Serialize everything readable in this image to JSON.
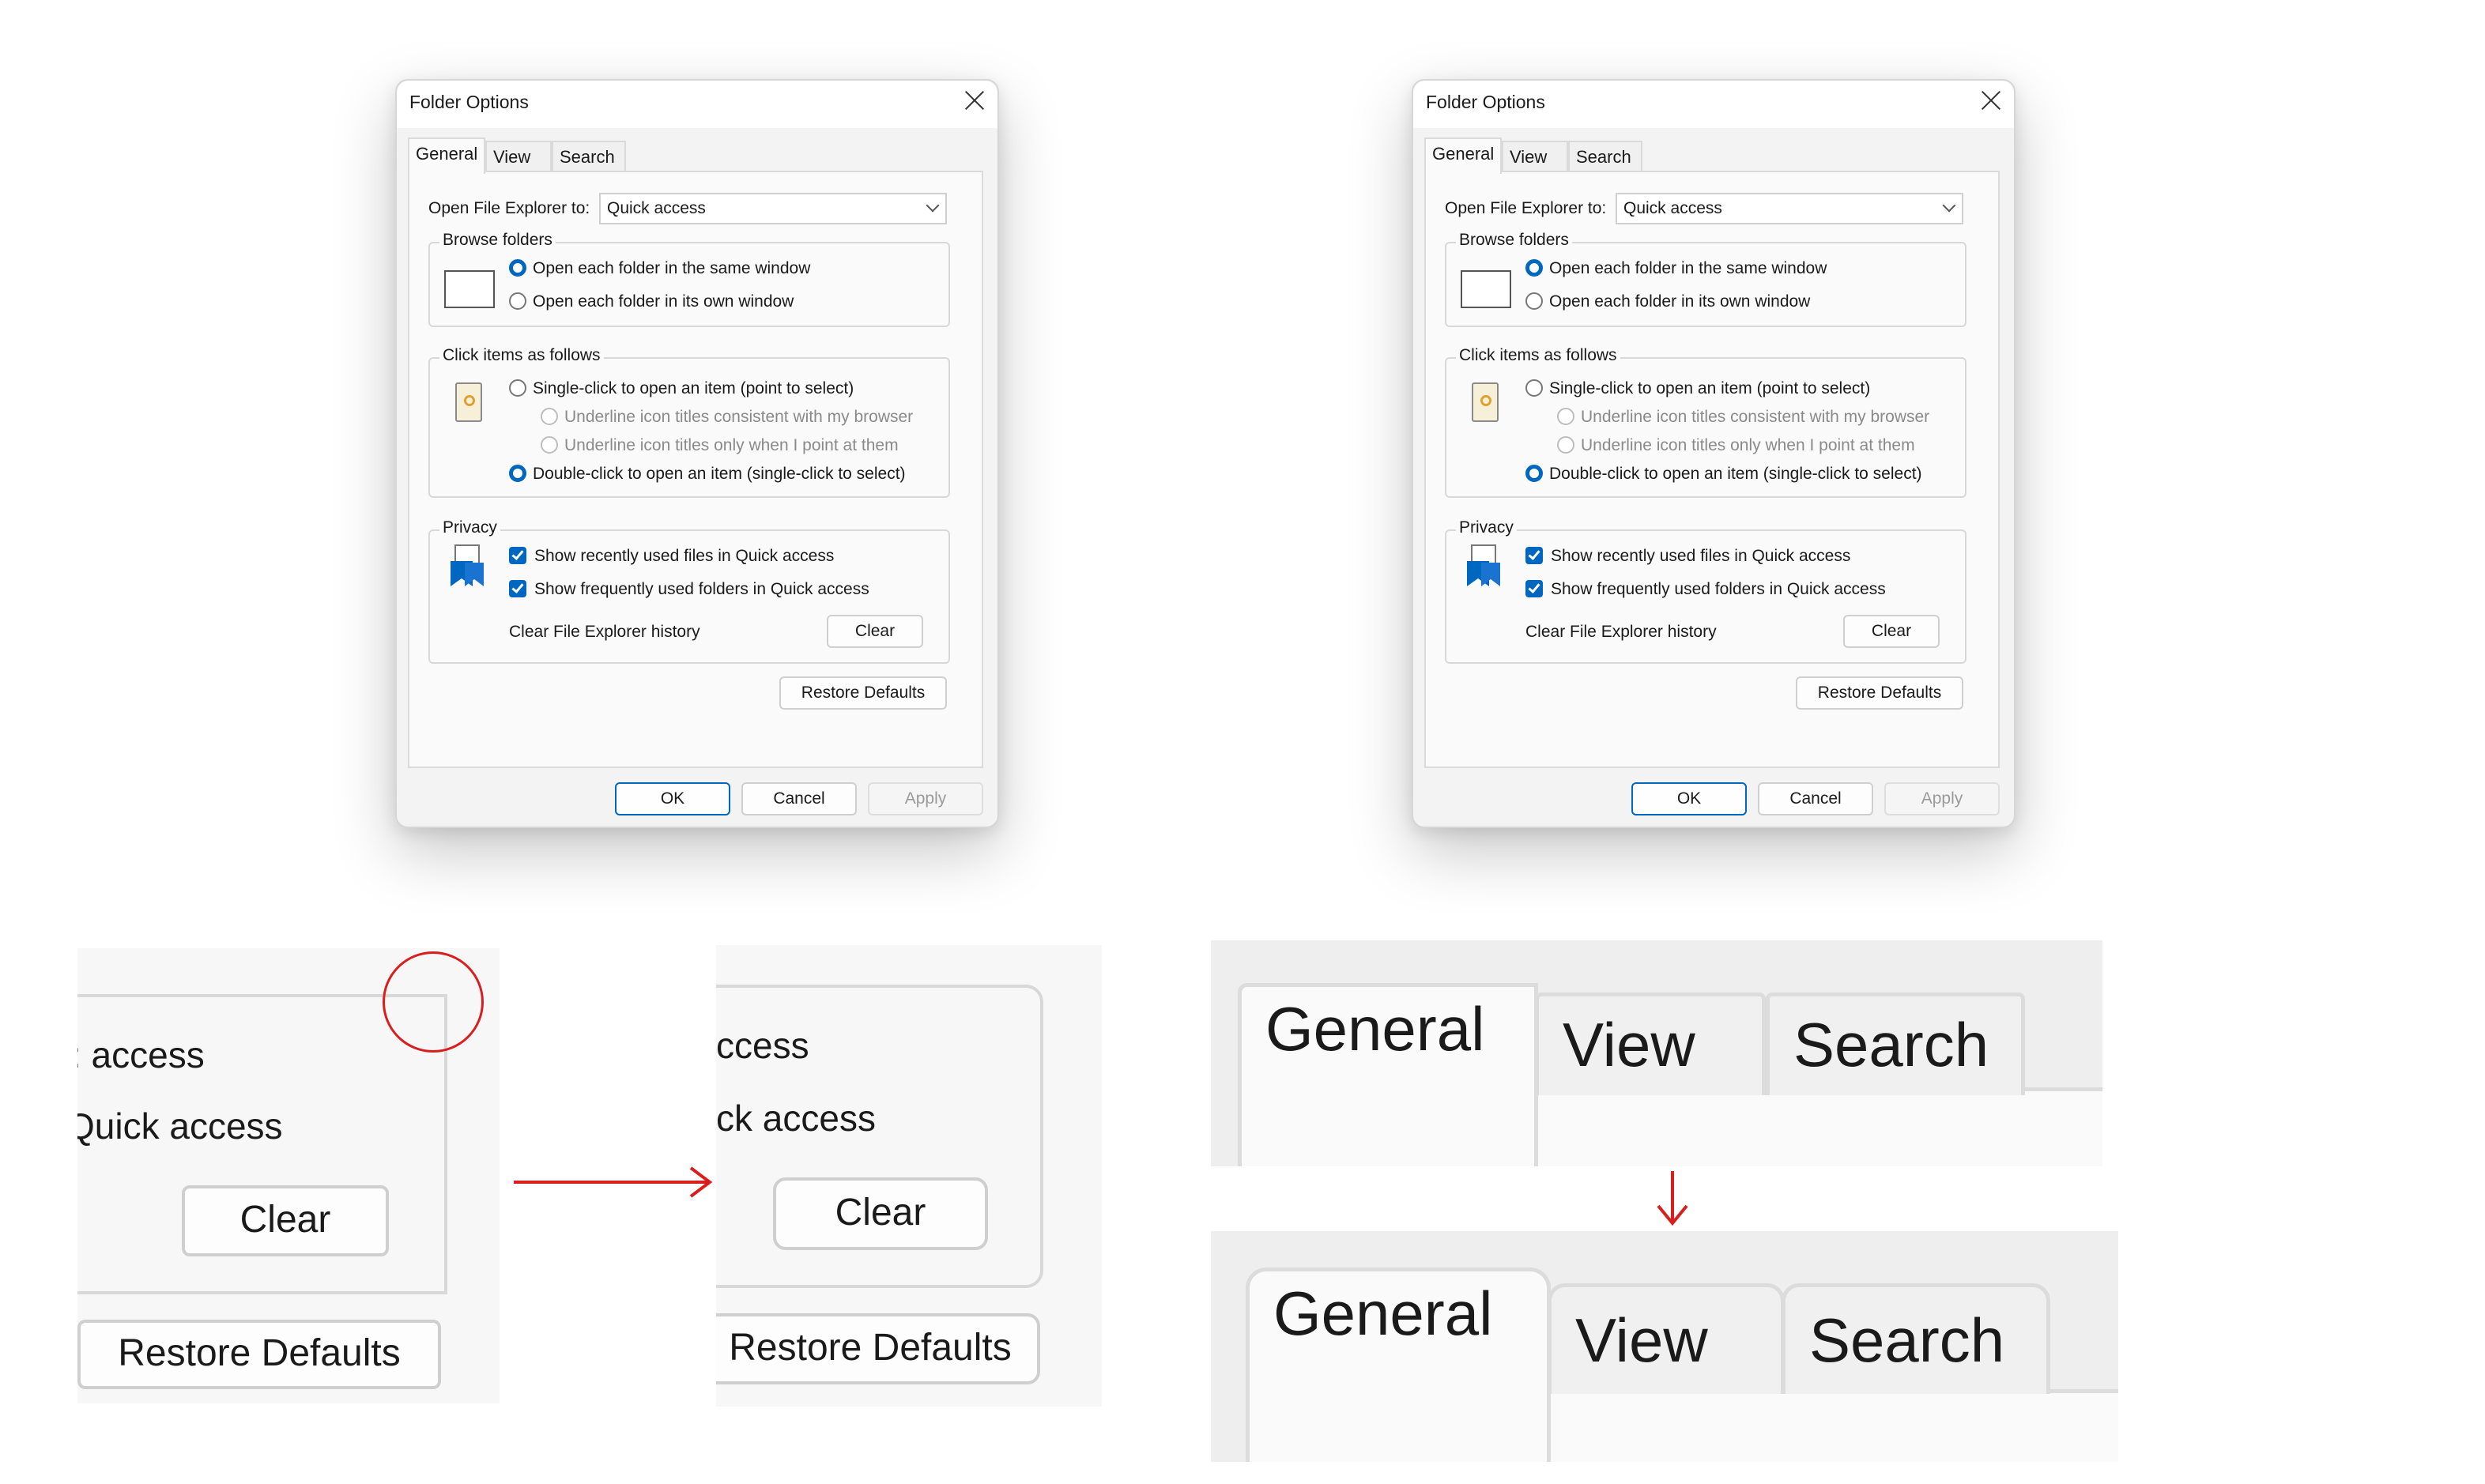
{
  "dialog": {
    "title": "Folder Options",
    "tabs": [
      "General",
      "View",
      "Search"
    ],
    "open_label": "Open File Explorer to:",
    "open_value": "Quick access",
    "browse": {
      "legend": "Browse folders",
      "options": [
        "Open each folder in the same window",
        "Open each folder in its own window"
      ],
      "selected": 0
    },
    "click": {
      "legend": "Click items as follows",
      "single": "Single-click to open an item (point to select)",
      "underline_browser": "Underline icon titles consistent with my browser",
      "underline_point": "Underline icon titles only when I point at them",
      "double": "Double-click to open an item (single-click to select)",
      "selected": "double"
    },
    "privacy": {
      "legend": "Privacy",
      "recent_files": "Show recently used files in Quick access",
      "frequent_folders": "Show frequently used folders in Quick access",
      "clear_label": "Clear File Explorer history",
      "clear_button": "Clear"
    },
    "restore_button": "Restore Defaults",
    "ok": "OK",
    "cancel": "Cancel",
    "apply": "Apply"
  },
  "zoom_before": {
    "line1": ": access",
    "line2": "Quick access",
    "clear": "Clear",
    "restore": "Restore Defaults"
  },
  "zoom_after": {
    "line1": "ccess",
    "line2": "ck access",
    "clear": "Clear",
    "restore": "Restore Defaults"
  },
  "tabs_zoom": {
    "before": [
      "General",
      "View",
      "Search"
    ],
    "after": [
      "General",
      "View",
      "Search"
    ]
  },
  "colors": {
    "accent": "#0067c0",
    "annotation": "#d91e1e"
  }
}
